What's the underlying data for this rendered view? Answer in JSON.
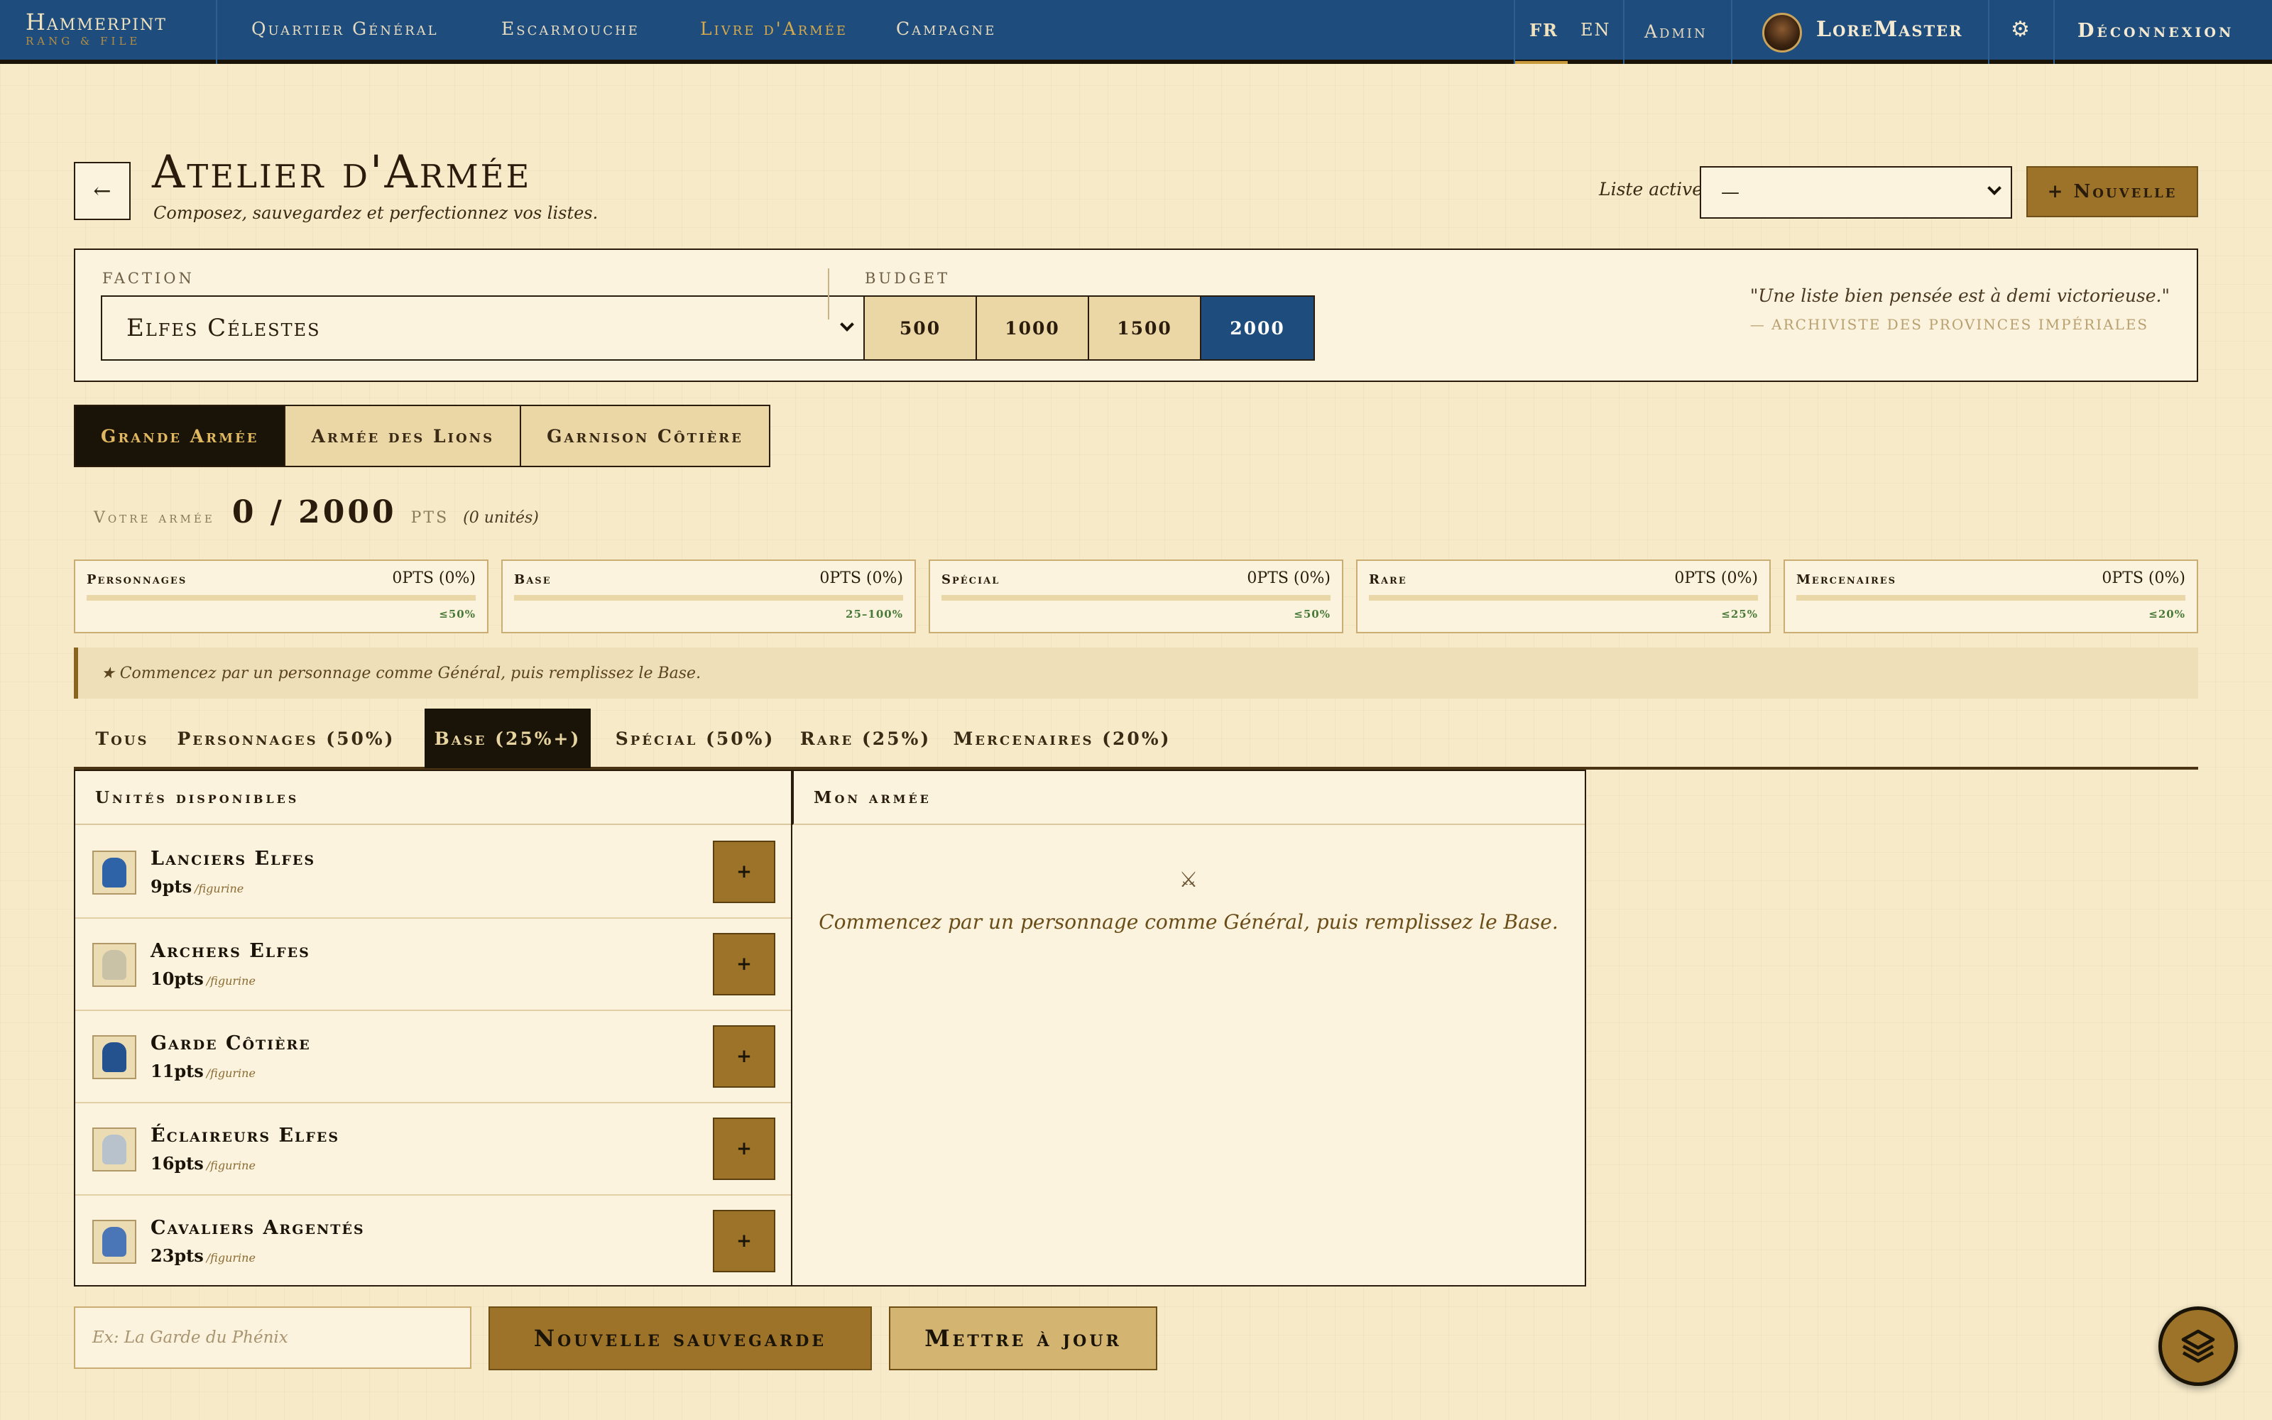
{
  "nav": {
    "logo_title": "Hammerpint",
    "logo_sub": "RANG & FILE",
    "links": [
      "Quartier Général",
      "Escarmouche",
      "Livre d'Armée",
      "Campagne"
    ],
    "active_link": "Livre d'Armée",
    "lang_fr": "FR",
    "lang_en": "EN",
    "admin": "Admin",
    "user": "LoreMaster",
    "gear_icon": "gear-icon",
    "logout": "Déconnexion"
  },
  "header": {
    "back_icon": "←",
    "title": "Atelier d'Armée",
    "subtitle": "Composez, sauvegardez et perfectionnez vos listes.",
    "active_list_label": "Liste active",
    "active_list_value": "—",
    "new_button": "+ Nouvelle"
  },
  "faction": {
    "label": "FACTION",
    "value": "Elfes Célestes",
    "budget_label": "BUDGET",
    "budgets": [
      "500",
      "1000",
      "1500",
      "2000"
    ],
    "budget_selected": "2000",
    "quote": "\"Une liste bien pensée est à demi victorieuse.\"",
    "quote_author": "— ARCHIVISTE DES PROVINCES IMPÉRIALES"
  },
  "army_tabs": [
    "Grande Armée",
    "Armée des Lions",
    "Garnison Côtière"
  ],
  "army_tab_selected": "Grande Armée",
  "points": {
    "label": "Votre armée",
    "value": "0 / 2000",
    "unit": "PTS",
    "units_count": "(0 unités)"
  },
  "categories": [
    {
      "name": "Personnages",
      "value": "0PTS (0%)",
      "limit": "≤50%",
      "fill": 0
    },
    {
      "name": "Base",
      "value": "0PTS (0%)",
      "limit": "25–100%",
      "fill": 0
    },
    {
      "name": "Spécial",
      "value": "0PTS (0%)",
      "limit": "≤50%",
      "fill": 0
    },
    {
      "name": "Rare",
      "value": "0PTS (0%)",
      "limit": "≤25%",
      "fill": 0
    },
    {
      "name": "Mercenaires",
      "value": "0PTS (0%)",
      "limit": "≤20%",
      "fill": 0
    }
  ],
  "hint": "★  Commencez par un personnage comme Général, puis remplissez le Base.",
  "filter_tabs": [
    "Tous",
    "Personnages (50%)",
    "Base (25%+)",
    "Spécial (50%)",
    "Rare (25%)",
    "Mercenaires (20%)"
  ],
  "filter_selected": "Base (25%+)",
  "available": {
    "title": "Unités disponibles",
    "units": [
      {
        "name": "Lanciers Elfes",
        "price": "9pts",
        "per": "/figurine",
        "color": "#2f63a8",
        "add": "+"
      },
      {
        "name": "Archers Elfes",
        "price": "10pts",
        "per": "/figurine",
        "color": "#c9c2a6",
        "add": "+"
      },
      {
        "name": "Garde Côtière",
        "price": "11pts",
        "per": "/figurine",
        "color": "#24528f",
        "add": "+"
      },
      {
        "name": "Éclaireurs Elfes",
        "price": "16pts",
        "per": "/figurine",
        "color": "#b8c2cc",
        "add": "+"
      },
      {
        "name": "Cavaliers Argentés",
        "price": "23pts",
        "per": "/figurine",
        "color": "#4a76b8",
        "add": "+"
      }
    ]
  },
  "my_army": {
    "title": "Mon armée",
    "empty_icon": "⚔",
    "empty_message": "Commencez par un personnage comme Général, puis remplissez le Base."
  },
  "save": {
    "placeholder": "Ex: La Garde du Phénix",
    "save_button": "Nouvelle sauvegarde",
    "update_button": "Mettre à jour"
  },
  "fab_icon": "layers-icon",
  "colors": {
    "nav_bg": "#1e4d7d",
    "accent_gold": "#9c7328",
    "page_bg": "#f6eac9",
    "dark": "#1a1308"
  }
}
